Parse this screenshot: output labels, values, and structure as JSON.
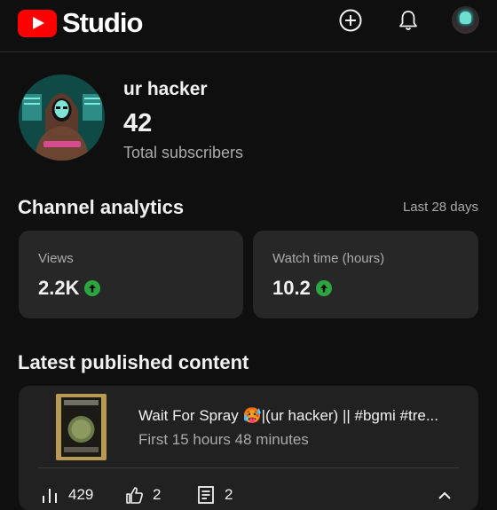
{
  "app": {
    "logo_text": "Studio",
    "icons": {
      "create": "add-circle-icon",
      "notifications": "bell-icon",
      "account": "account-avatar"
    }
  },
  "channel": {
    "name": "ur hacker",
    "subscriber_count": "42",
    "subscriber_label": "Total subscribers"
  },
  "analytics": {
    "title": "Channel analytics",
    "range": "Last 28 days",
    "cards": [
      {
        "label": "Views",
        "value": "2.2K",
        "trend": "up"
      },
      {
        "label": "Watch time (hours)",
        "value": "10.2",
        "trend": "up"
      }
    ]
  },
  "latest": {
    "title": "Latest published content",
    "video": {
      "title": "Wait For Spray 🥵|(ur hacker) || #bgmi #tre...",
      "subtitle": "First 15 hours 48 minutes",
      "views": "429",
      "likes": "2",
      "comments": "2"
    }
  },
  "colors": {
    "background": "#0f0f0f",
    "card": "#272727",
    "accent": "#ff0000",
    "trend_up": "#2ba640"
  }
}
